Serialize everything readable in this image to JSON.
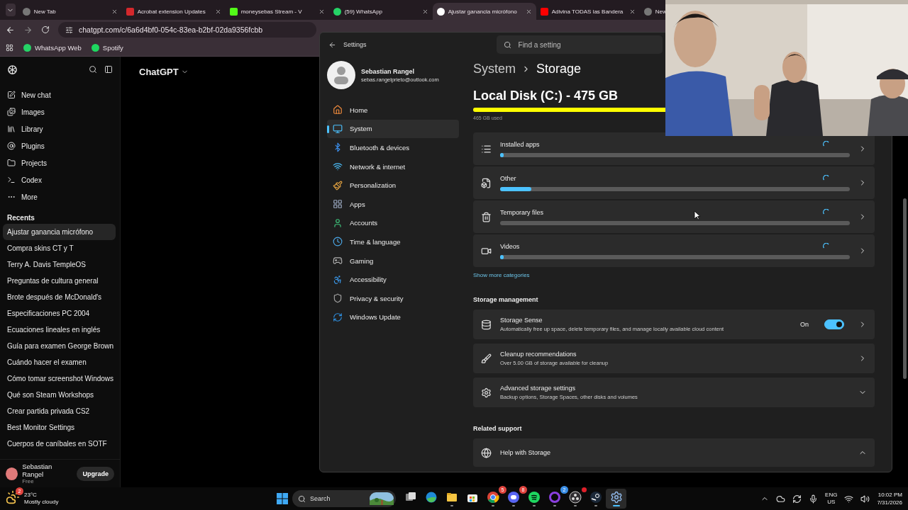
{
  "browser": {
    "tabs": [
      {
        "title": "New Tab",
        "kind": "newtab",
        "selected": false
      },
      {
        "title": "Acrobat extension Updates",
        "kind": "acrobat",
        "selected": false
      },
      {
        "title": "moneysebas Stream - V",
        "kind": "kick",
        "selected": false
      },
      {
        "title": "(59) WhatsApp",
        "kind": "whatsapp",
        "selected": false
      },
      {
        "title": "Ajustar ganancia micrófono",
        "kind": "chatgpt",
        "selected": true
      },
      {
        "title": "Adivina TODAS las Bandera",
        "kind": "youtube",
        "selected": false
      },
      {
        "title": "New",
        "kind": "newtab",
        "selected": false
      }
    ],
    "address": "chatgpt.com/c/6a6d4bf0-054c-83ea-b2bf-02da9356fcbb",
    "bookmarks": [
      {
        "title": "WhatsApp Web",
        "kind": "whatsapp"
      },
      {
        "title": "Spotify",
        "kind": "spotify"
      }
    ]
  },
  "chatgpt": {
    "title": "ChatGPT",
    "nav": [
      "New chat",
      "Images",
      "Library",
      "Plugins",
      "Projects",
      "Codex",
      "More"
    ],
    "recents_heading": "Recents",
    "recents": [
      {
        "title": "Ajustar ganancia micrófono",
        "selected": true
      },
      {
        "title": "Compra skins CT y T",
        "selected": false
      },
      {
        "title": "Terry A. Davis TempleOS",
        "selected": false
      },
      {
        "title": "Preguntas de cultura general",
        "selected": false
      },
      {
        "title": "Brote después de McDonald's",
        "selected": false
      },
      {
        "title": "Especificaciones PC 2004",
        "selected": false
      },
      {
        "title": "Ecuaciones lineales en inglés",
        "selected": false
      },
      {
        "title": "Guía para examen George Brown",
        "selected": false
      },
      {
        "title": "Cuándo hacer el examen",
        "selected": false
      },
      {
        "title": "Cómo tomar screenshot Windows",
        "selected": false
      },
      {
        "title": "Qué son Steam Workshops",
        "selected": false
      },
      {
        "title": "Crear partida privada CS2",
        "selected": false
      },
      {
        "title": "Best Monitor Settings",
        "selected": false
      },
      {
        "title": "Cuerpos de caníbales en SOTF",
        "selected": false
      }
    ],
    "user": {
      "name": "Sebastian Rangel",
      "plan": "Free"
    },
    "upgrade": "Upgrade"
  },
  "settings": {
    "title": "Settings",
    "search": {
      "placeholder": "Find a setting"
    },
    "profile": {
      "name": "Sebastian Rangel",
      "email": "sebas.rangelprieto@outlook.com"
    },
    "nav": [
      {
        "label": "Home",
        "selected": false
      },
      {
        "label": "System",
        "selected": true
      },
      {
        "label": "Bluetooth & devices",
        "selected": false
      },
      {
        "label": "Network & internet",
        "selected": false
      },
      {
        "label": "Personalization",
        "selected": false
      },
      {
        "label": "Apps",
        "selected": false
      },
      {
        "label": "Accounts",
        "selected": false
      },
      {
        "label": "Time & language",
        "selected": false
      },
      {
        "label": "Gaming",
        "selected": false
      },
      {
        "label": "Accessibility",
        "selected": false
      },
      {
        "label": "Privacy & security",
        "selected": false
      },
      {
        "label": "Windows Update",
        "selected": false
      }
    ],
    "breadcrumb": [
      "System",
      "Storage"
    ],
    "disk": {
      "title": "Local Disk (C:) - 475 GB",
      "level": 0.98,
      "used": "465 GB used"
    },
    "categories": [
      {
        "name": "Installed apps",
        "kind": "apps",
        "level": 0.01
      },
      {
        "name": "Other",
        "kind": "other",
        "level": 0.09
      },
      {
        "name": "Temporary files",
        "kind": "temp"
      },
      {
        "name": "Videos",
        "kind": "videos",
        "level": 0.01
      }
    ],
    "show_more": "Show more categories",
    "management_heading": "Storage management",
    "management": [
      {
        "kind": "toggle",
        "title": "Storage Sense",
        "description": "Automatically free up space, delete temporary files, and manage locally available cloud content",
        "state_label": "On",
        "on": true
      },
      {
        "kind": "link",
        "title": "Cleanup recommendations",
        "description": "Over 5.00 GB of storage available for cleanup"
      },
      {
        "kind": "expander",
        "title": "Advanced storage settings",
        "description": "Backup options, Storage Spaces, other disks and volumes",
        "expanded": false
      }
    ],
    "support_heading": "Related support",
    "support": [
      {
        "title": "Help with Storage",
        "expanded": true
      }
    ]
  },
  "taskbar": {
    "weather": {
      "temp": "23°C",
      "condition": "Mostly cloudy",
      "badge": "2"
    },
    "search": {
      "placeholder": "Search"
    },
    "apps": [
      {
        "kind": "taskview",
        "open": false,
        "selected": false
      },
      {
        "kind": "edge",
        "open": false,
        "selected": false
      },
      {
        "kind": "explorer",
        "open": true,
        "selected": false
      },
      {
        "kind": "store",
        "open": false,
        "selected": false
      },
      {
        "kind": "chrome",
        "badge": "5",
        "open": true,
        "selected": false
      },
      {
        "kind": "discord",
        "badge": "8",
        "open": true,
        "selected": false
      },
      {
        "kind": "spotify",
        "open": true,
        "selected": false
      },
      {
        "kind": "ring",
        "badge": "2",
        "open": true,
        "selected": false
      },
      {
        "kind": "obs",
        "dot": true,
        "open": true,
        "selected": false
      },
      {
        "kind": "steam",
        "open": true,
        "selected": false
      },
      {
        "kind": "settings",
        "open": true,
        "selected": true
      }
    ],
    "language": [
      "ENG",
      "US"
    ],
    "time": "10:02 PM",
    "date": "7/31/2026"
  }
}
